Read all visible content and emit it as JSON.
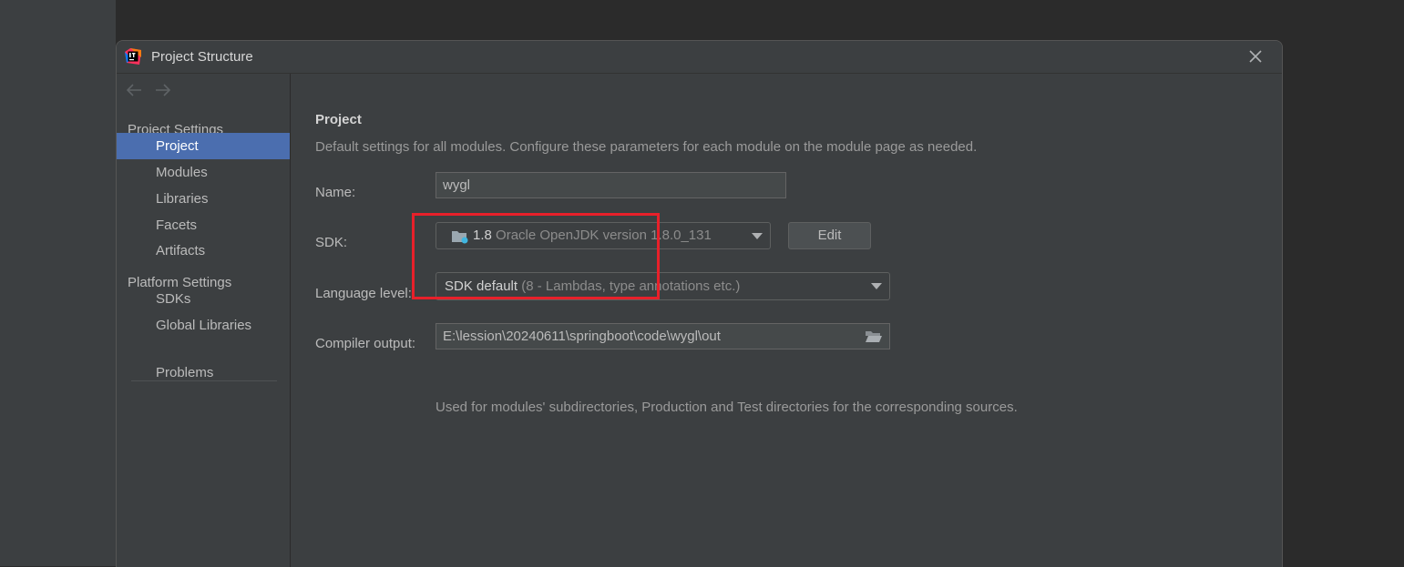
{
  "window": {
    "title": "Project Structure"
  },
  "sidebar": {
    "groups": [
      {
        "label": "Project Settings"
      },
      {
        "label": "Platform Settings"
      }
    ],
    "items": [
      {
        "label": "Project"
      },
      {
        "label": "Modules"
      },
      {
        "label": "Libraries"
      },
      {
        "label": "Facets"
      },
      {
        "label": "Artifacts"
      },
      {
        "label": "SDKs"
      },
      {
        "label": "Global Libraries"
      },
      {
        "label": "Problems"
      }
    ],
    "selected": "Project"
  },
  "project": {
    "title": "Project",
    "description": "Default settings for all modules. Configure these parameters for each module on the module page as needed.",
    "name_label": "Name:",
    "name_value": "wygl",
    "sdk_label": "SDK:",
    "sdk_version": "1.8",
    "sdk_detail": "Oracle OpenJDK version 1.8.0_131",
    "edit_label": "Edit",
    "language_level_label": "Language level:",
    "language_level_value": "SDK default",
    "language_level_detail": "(8 - Lambdas, type annotations etc.)",
    "compiler_output_label": "Compiler output:",
    "compiler_output_value": "E:\\lession\\20240611\\springboot\\code\\wygl\\out",
    "compiler_output_hint": "Used for modules' subdirectories, Production and Test directories for the corresponding sources."
  },
  "icons": {
    "app": "intellij-icon",
    "close": "close-icon",
    "back": "arrow-left-icon",
    "forward": "arrow-right-icon",
    "sdk": "jdk-folder-icon",
    "browse": "folder-icon"
  },
  "colors": {
    "selection": "#4b6eaf",
    "annotation": "#e8202a"
  }
}
